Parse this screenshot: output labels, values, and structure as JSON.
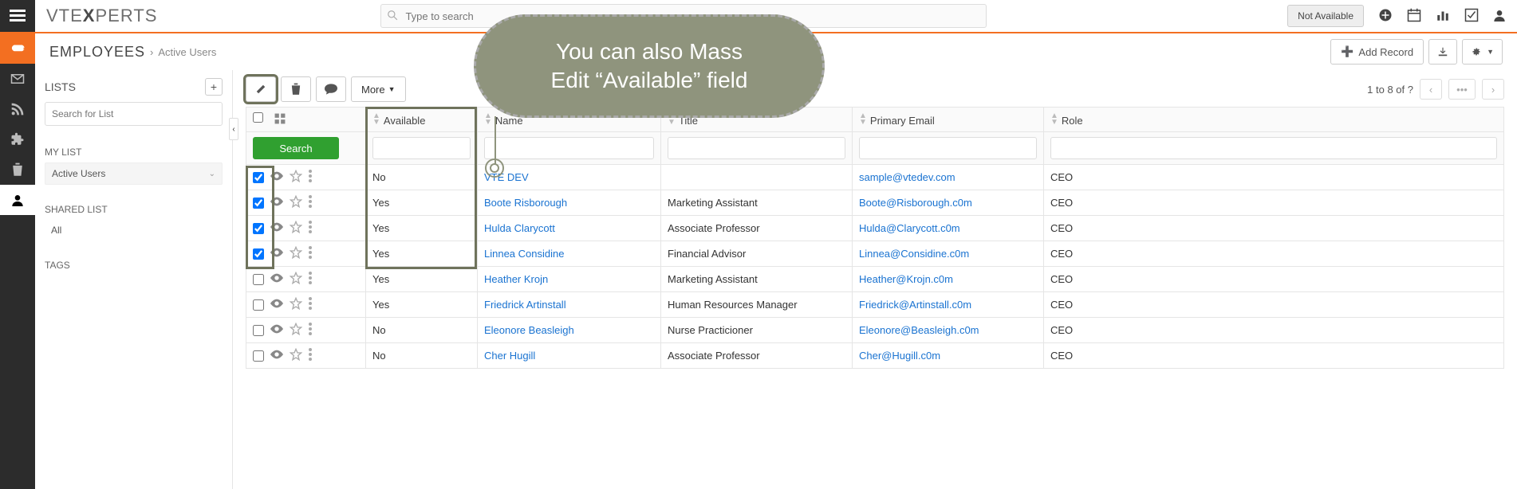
{
  "header": {
    "logo_pre": "VTE",
    "logo_mid": "X",
    "logo_post": "PERTS",
    "search_placeholder": "Type to search",
    "availability": "Not Available"
  },
  "breadcrumb": {
    "module": "EMPLOYEES",
    "sub": "Active Users",
    "add_record": "Add Record"
  },
  "sidebar": {
    "lists_title": "LISTS",
    "search_placeholder": "Search for List",
    "my_list_title": "MY LIST",
    "my_list_item": "Active Users",
    "shared_list_title": "SHARED LIST",
    "shared_all": "All",
    "tags_title": "TAGS"
  },
  "actionbar": {
    "more": "More",
    "pager_text": "1 to 8  of ?",
    "search_btn": "Search"
  },
  "columns": {
    "available": "Available",
    "name": "Name",
    "title": "Title",
    "email": "Primary Email",
    "role": "Role"
  },
  "rows": [
    {
      "checked": true,
      "available": "No",
      "name": "VTE DEV",
      "title": "",
      "email": "sample@vtedev.com",
      "role": "CEO"
    },
    {
      "checked": true,
      "available": "Yes",
      "name": "Boote Risborough",
      "title": "Marketing Assistant",
      "email": "Boote@Risborough.c0m",
      "role": "CEO"
    },
    {
      "checked": true,
      "available": "Yes",
      "name": "Hulda Clarycott",
      "title": "Associate Professor",
      "email": "Hulda@Clarycott.c0m",
      "role": "CEO"
    },
    {
      "checked": true,
      "available": "Yes",
      "name": "Linnea Considine",
      "title": "Financial Advisor",
      "email": "Linnea@Considine.c0m",
      "role": "CEO"
    },
    {
      "checked": false,
      "available": "Yes",
      "name": "Heather Krojn",
      "title": "Marketing Assistant",
      "email": "Heather@Krojn.c0m",
      "role": "CEO"
    },
    {
      "checked": false,
      "available": "Yes",
      "name": "Friedrick Artinstall",
      "title": "Human Resources Manager",
      "email": "Friedrick@Artinstall.c0m",
      "role": "CEO"
    },
    {
      "checked": false,
      "available": "No",
      "name": "Eleonore Beasleigh",
      "title": "Nurse Practicioner",
      "email": "Eleonore@Beasleigh.c0m",
      "role": "CEO"
    },
    {
      "checked": false,
      "available": "No",
      "name": "Cher Hugill",
      "title": "Associate Professor",
      "email": "Cher@Hugill.c0m",
      "role": "CEO"
    }
  ],
  "callout": {
    "line1": "You can also Mass",
    "line2": "Edit “Available” field"
  }
}
